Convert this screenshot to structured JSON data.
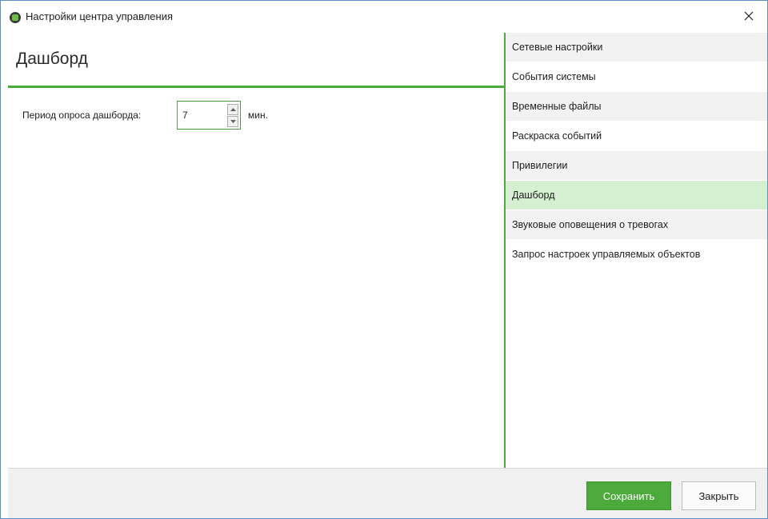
{
  "window": {
    "title": "Настройки центра управления"
  },
  "content": {
    "page_title": "Дашборд",
    "poll_period_label": "Период опроса дашборда:",
    "poll_period_value": "7",
    "poll_period_unit": "мин."
  },
  "nav": {
    "items": [
      {
        "label": "Сетевые настройки"
      },
      {
        "label": "События системы"
      },
      {
        "label": "Временные файлы"
      },
      {
        "label": "Раскраска событий"
      },
      {
        "label": "Привилегии"
      },
      {
        "label": "Дашборд"
      },
      {
        "label": "Звуковые оповещения о тревогах"
      },
      {
        "label": "Запрос настроек управляемых объектов"
      }
    ],
    "selected_index": 5
  },
  "footer": {
    "save_label": "Сохранить",
    "close_label": "Закрыть"
  },
  "colors": {
    "accent": "#4caa3c",
    "selected_bg": "#d5efd1"
  }
}
